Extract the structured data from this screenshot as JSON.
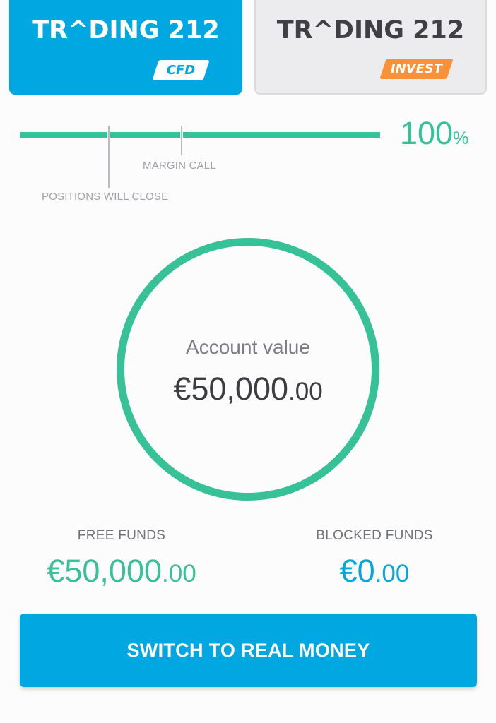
{
  "tabs": [
    {
      "brand": "TR^DING 212",
      "product": "CFD",
      "active": true
    },
    {
      "brand": "TR^DING 212",
      "product": "INVEST",
      "active": false
    }
  ],
  "margin_level": {
    "percent_value": "100",
    "percent_sign": "%",
    "level": 100,
    "margin_call_label": "MARGIN CALL",
    "positions_close_label": "POSITIONS WILL CLOSE"
  },
  "account": {
    "title": "Account value",
    "value_main": "€50,000",
    "value_cents": ".00"
  },
  "funds": {
    "free_label": "FREE FUNDS",
    "free_main": "€50,000",
    "free_cents": ".00",
    "blocked_label": "BLOCKED FUNDS",
    "blocked_main": "€0",
    "blocked_cents": ".00"
  },
  "switch_button": {
    "label": "SWITCH TO REAL MONEY"
  },
  "colors": {
    "accent_blue": "#00a7e1",
    "accent_green": "#37c196",
    "accent_orange": "#f7923b"
  }
}
